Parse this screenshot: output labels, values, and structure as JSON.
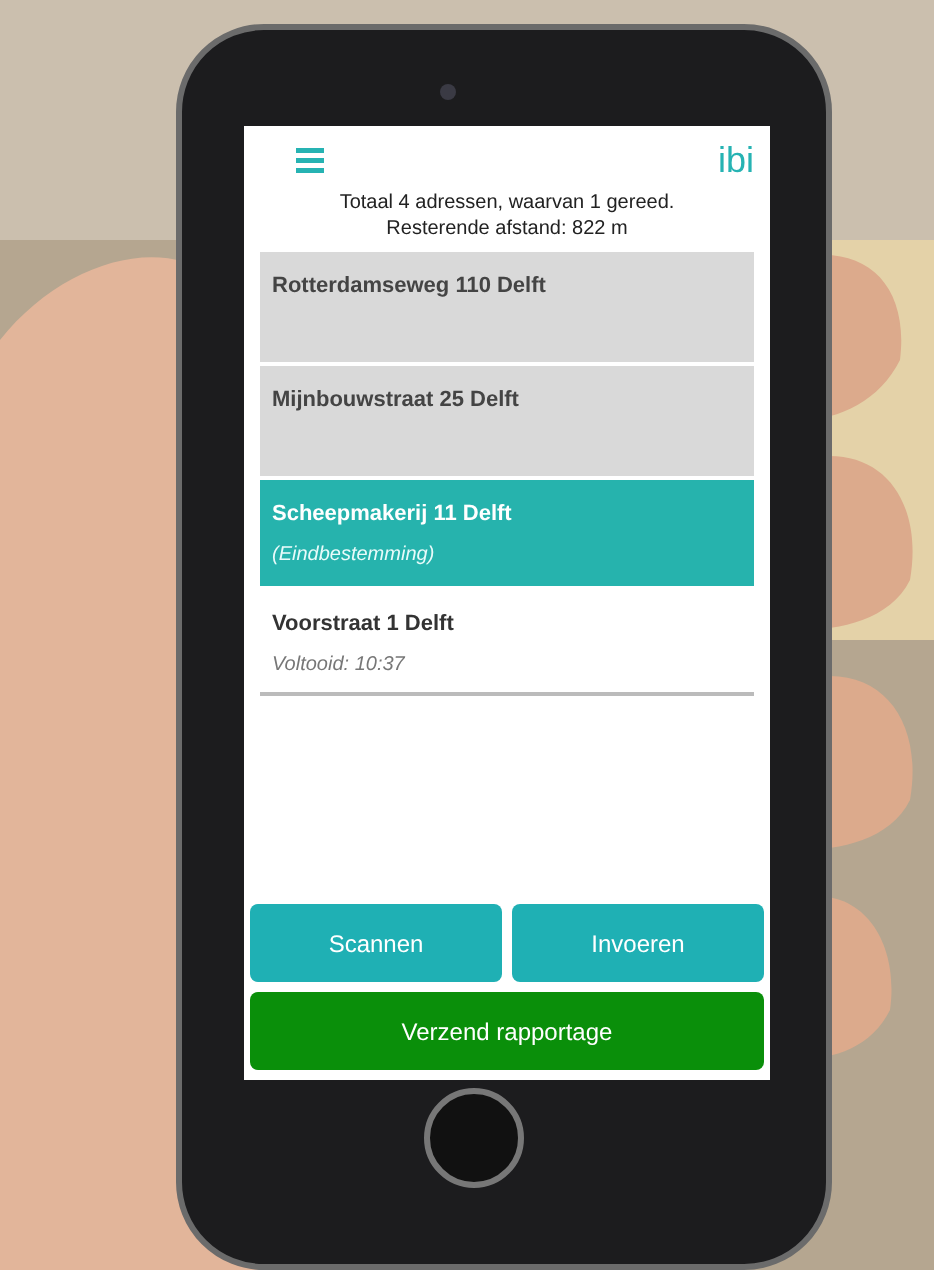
{
  "app": {
    "logo": "ibi"
  },
  "summary": [
    "Totaal 4 adressen, waarvan 1 gereed.",
    "Resterende afstand: 822 m"
  ],
  "addresses": [
    {
      "address": "Rotterdamseweg 110 Delft",
      "kind": "pending"
    },
    {
      "address": "Mijnbouwstraat 25 Delft",
      "kind": "pending"
    },
    {
      "address": "Scheepmakerij 11 Delft",
      "note": "(Eindbestemming)",
      "kind": "current"
    },
    {
      "address": "Voorstraat 1 Delft",
      "note": "Voltooid: 10:37",
      "kind": "done"
    }
  ],
  "buttons": [
    {
      "label": "Scannen",
      "kind": "action"
    },
    {
      "label": "Invoeren",
      "kind": "action"
    },
    {
      "label": "Verzend rapportage",
      "kind": "submit"
    }
  ]
}
